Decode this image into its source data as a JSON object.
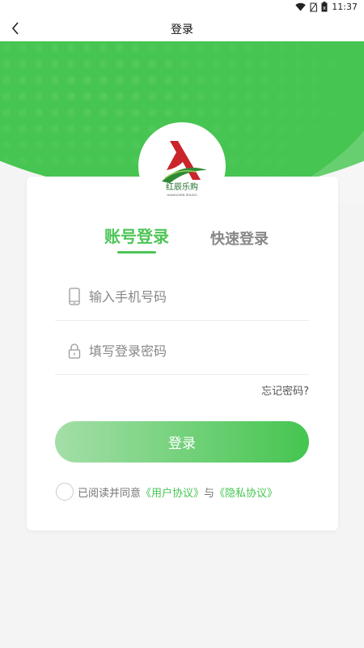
{
  "status_bar": {
    "time": "11:37",
    "icons": [
      "wifi-icon",
      "no-sim-icon",
      "battery-icon"
    ]
  },
  "nav": {
    "title": "登录",
    "back_icon": "chevron-left-icon"
  },
  "logo": {
    "brand_cn": "红辰乐购",
    "brand_en": "HANGCHEN SHUGO"
  },
  "tabs": [
    {
      "label": "账号登录",
      "active": true
    },
    {
      "label": "快速登录",
      "active": false
    }
  ],
  "form": {
    "phone_placeholder": "输入手机号码",
    "phone_icon": "phone-icon",
    "password_placeholder": "填写登录密码",
    "password_icon": "lock-icon",
    "forgot_label": "忘记密码?",
    "login_label": "登录"
  },
  "agreement": {
    "prefix": "已阅读并同意",
    "user_agreement": "《用户协议》",
    "connector": "与",
    "privacy_agreement": "《隐私协议》"
  },
  "colors": {
    "brand_green": "#47c552",
    "button_gradient_start": "#a4dea8",
    "button_gradient_end": "#45c550",
    "logo_red": "#c9252b"
  }
}
